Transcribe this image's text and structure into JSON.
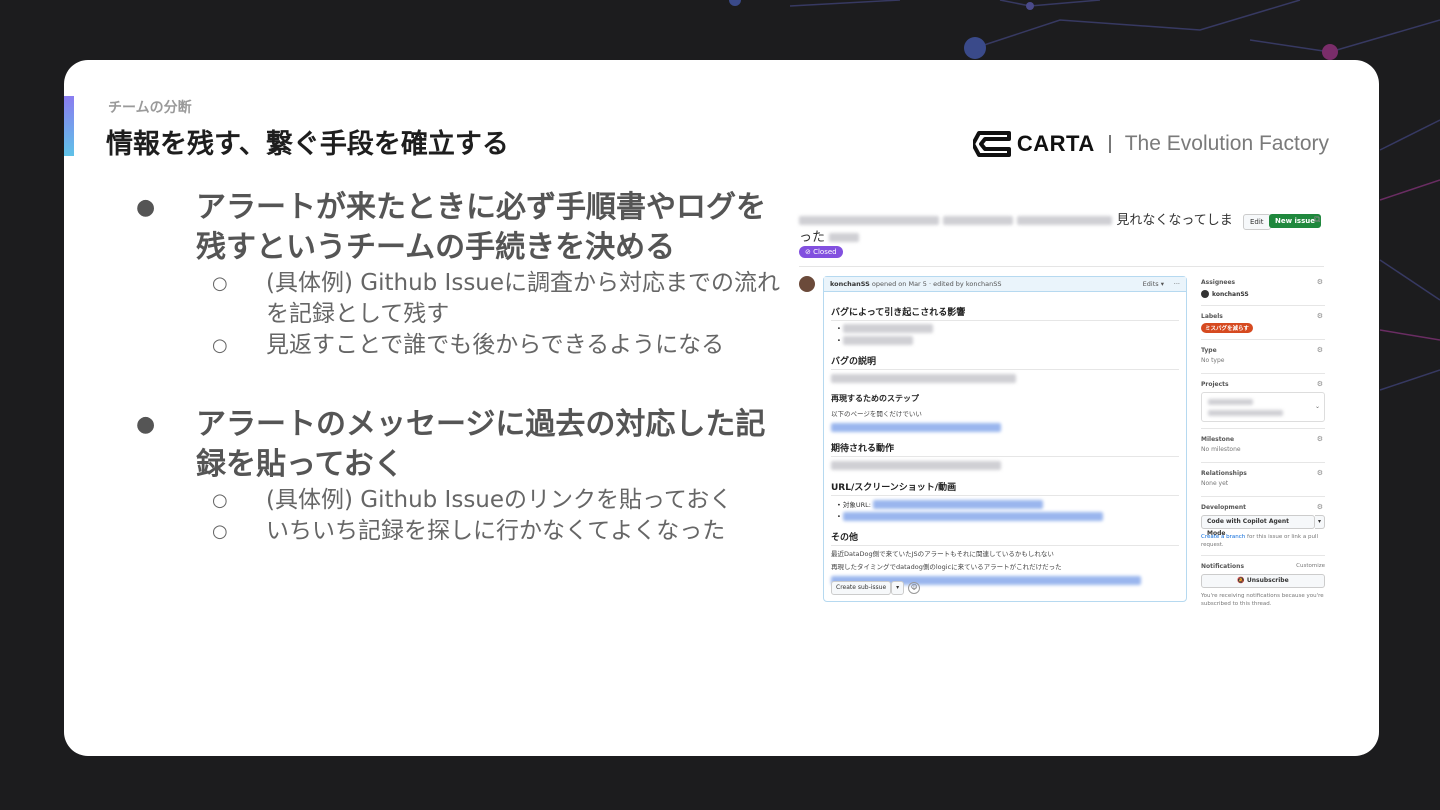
{
  "header": {
    "section": "チームの分断",
    "title": "情報を残す、繋ぐ手段を確立する"
  },
  "brand": {
    "name": "CARTA",
    "tagline": "The Evolution Factory"
  },
  "bullets": [
    {
      "text": "アラートが来たときに必ず手順書やログを残すというチームの手続きを決める",
      "subs": [
        "(具体例) Github Issueに調査から対応までの流れを記録として残す",
        "見返すことで誰でも後からできるようになる"
      ]
    },
    {
      "text": "アラートのメッセージに過去の対応した記録を貼っておく",
      "subs": [
        "(具体例) Github Issueのリンクを貼っておく",
        "いちいち記録を探しに行かなくてよくなった"
      ]
    }
  ],
  "bullet_marks": {
    "primary": "●",
    "secondary": "○"
  },
  "screenshot": {
    "title_visible_1": "見れなくなってしま",
    "title_visible_2": "った",
    "edit_button": "Edit",
    "new_issue_button": "New issue",
    "status": "Closed",
    "comment": {
      "author": "konchanSS",
      "meta": "opened on Mar 5 · edited by konchanSS",
      "edits": "Edits",
      "more": "···",
      "heading_impact": "バグによって引き起こされる影響",
      "heading_description": "バグの説明",
      "heading_steps": "再現するためのステップ",
      "steps_text": "以下のページを開くだけでいい",
      "heading_expected": "期待される動作",
      "heading_url": "URL/スクリーンショット/動画",
      "url_item": "対象URL:",
      "heading_other": "その他",
      "other_line1": "最近DataDog側で来ていたJSのアラートもそれに関連しているかもしれない",
      "other_line2": "再現したタイミングでdatadog側のlogicに来ているアラートがこれだけだった",
      "create_subissue": "Create sub-issue",
      "dropdown": "▾",
      "smile": "☺"
    },
    "sidebar": {
      "assignees_label": "Assignees",
      "assignee": "konchanSS",
      "labels_label": "Labels",
      "label_chip": "ミスバグを減らす",
      "type_label": "Type",
      "type_value": "No type",
      "projects_label": "Projects",
      "milestone_label": "Milestone",
      "milestone_value": "No milestone",
      "relationships_label": "Relationships",
      "relationships_value": "None yet",
      "development_label": "Development",
      "copilot_button": "Code with Copilot Agent Mode",
      "create_branch_link": "Create a branch",
      "create_branch_rest": " for this issue or link a pull request.",
      "notifications_label": "Notifications",
      "customize": "Customize",
      "unsubscribe": "Unsubscribe",
      "notify_note": "You're receiving notifications because you're subscribed to this thread."
    }
  },
  "colors": {
    "background": "#1c1c1e",
    "card": "#ffffff",
    "accent_top": "#8a7cf0",
    "accent_bottom": "#5fc2e8",
    "closed_badge": "#8250df",
    "new_issue": "#1f883d",
    "label_chip": "#d64a20"
  }
}
